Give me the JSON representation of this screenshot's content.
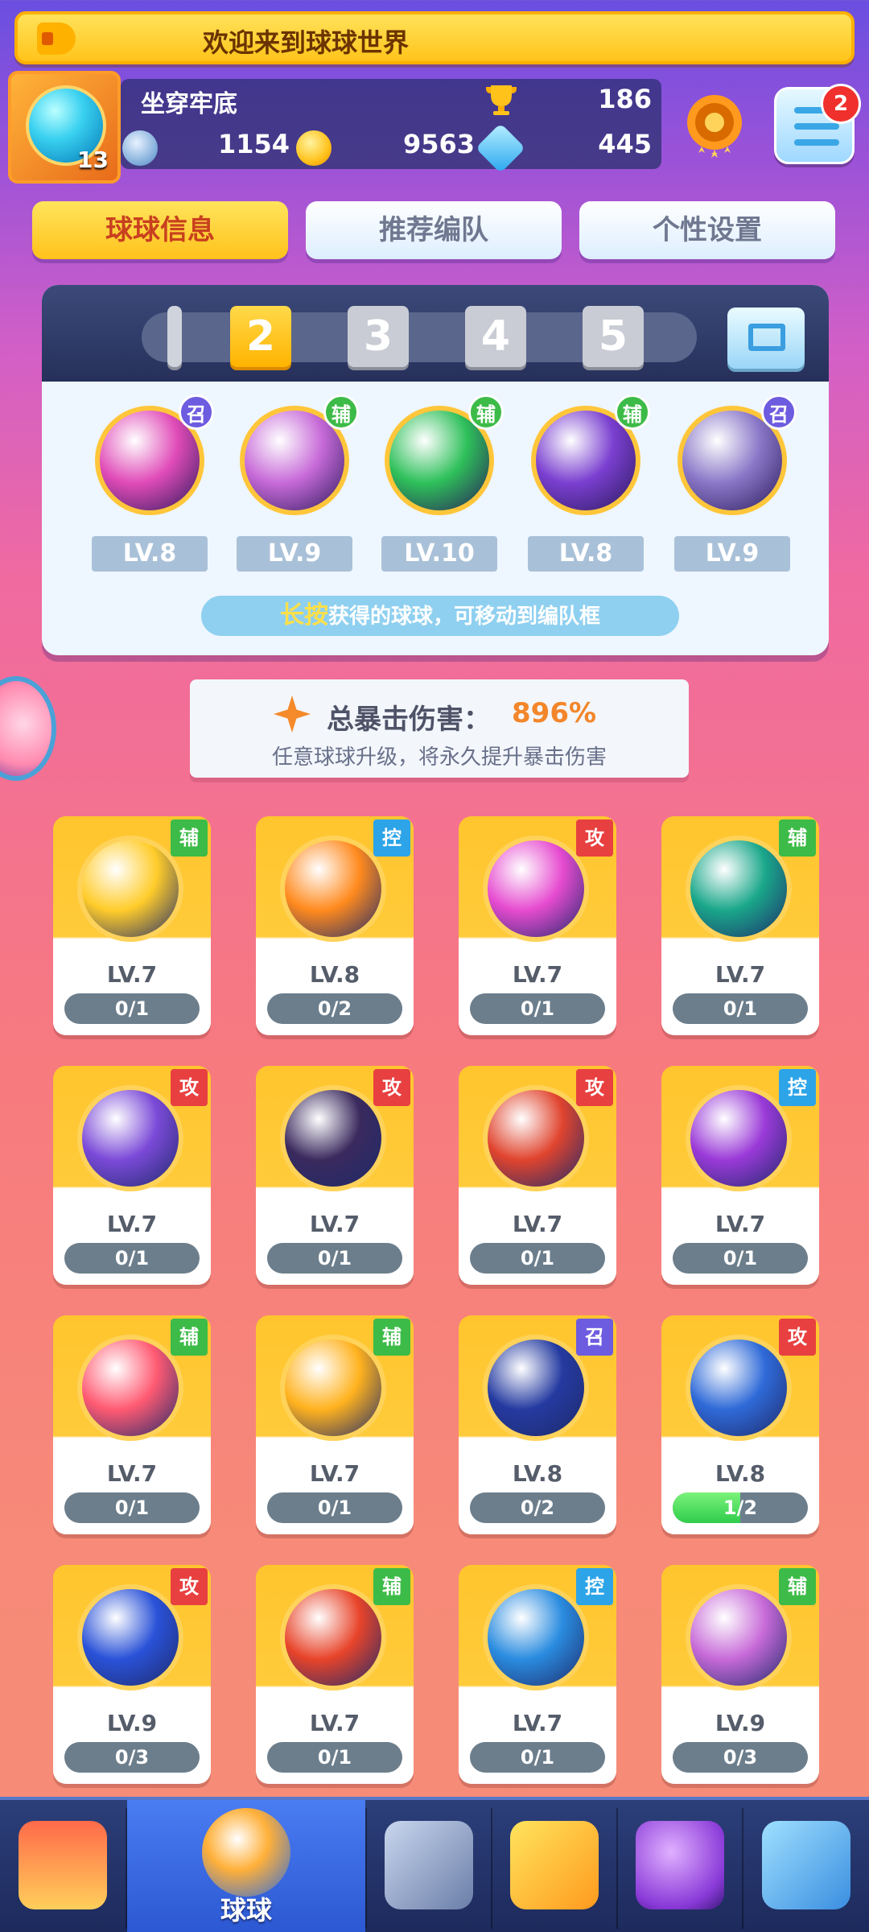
{
  "announcement": "欢迎来到球球世界",
  "player": {
    "name": "坐穿牢底",
    "level": "13",
    "trophies": "186",
    "resources": [
      {
        "icon": "blue-orb-icon",
        "value": "1154"
      },
      {
        "icon": "gold-coin-icon",
        "value": "9563"
      },
      {
        "icon": "diamond-icon",
        "value": "445"
      }
    ]
  },
  "menu": {
    "badge": "2"
  },
  "tabs": [
    {
      "label": "球球信息",
      "active": true
    },
    {
      "label": "推荐编队",
      "active": false
    },
    {
      "label": "个性设置",
      "active": false
    }
  ],
  "team": {
    "numbers": [
      "2",
      "3",
      "4",
      "5"
    ],
    "active_number": "2",
    "slots": [
      {
        "tag": "召",
        "level": "LV.8",
        "color": "#e04bb8"
      },
      {
        "tag": "辅",
        "level": "LV.9",
        "color": "#c76ad8"
      },
      {
        "tag": "辅",
        "level": "LV.10",
        "color": "#2ec05a"
      },
      {
        "tag": "辅",
        "level": "LV.8",
        "color": "#7a3fd0"
      },
      {
        "tag": "召",
        "level": "LV.9",
        "color": "#8a78c8"
      }
    ],
    "hint_highlight": "长按",
    "hint_text": "获得的球球，可移动到编队框"
  },
  "crit": {
    "label": "总暴击伤害：",
    "value": "896%",
    "sub": "任意球球升级，将永久提升暴击伤害"
  },
  "balls": [
    {
      "tag": "辅",
      "type": "aux",
      "level": "LV.7",
      "progress": "0/1",
      "fill": 0,
      "color": "#ffcc2a"
    },
    {
      "tag": "控",
      "type": "ctl",
      "level": "LV.8",
      "progress": "0/2",
      "fill": 0,
      "color": "#ff8a1e"
    },
    {
      "tag": "攻",
      "type": "atk",
      "level": "LV.7",
      "progress": "0/1",
      "fill": 0,
      "color": "#e64bd0"
    },
    {
      "tag": "辅",
      "type": "aux",
      "level": "LV.7",
      "progress": "0/1",
      "fill": 0,
      "color": "#1aa78a"
    },
    {
      "tag": "攻",
      "type": "atk",
      "level": "LV.7",
      "progress": "0/1",
      "fill": 0,
      "color": "#7b4ad8"
    },
    {
      "tag": "攻",
      "type": "atk",
      "level": "LV.7",
      "progress": "0/1",
      "fill": 0,
      "color": "#3a2a5e"
    },
    {
      "tag": "攻",
      "type": "atk",
      "level": "LV.7",
      "progress": "0/1",
      "fill": 0,
      "color": "#e0442e"
    },
    {
      "tag": "控",
      "type": "ctl",
      "level": "LV.7",
      "progress": "0/1",
      "fill": 0,
      "color": "#9a3ad8"
    },
    {
      "tag": "辅",
      "type": "aux",
      "level": "LV.7",
      "progress": "0/1",
      "fill": 0,
      "color": "#ff5a72"
    },
    {
      "tag": "辅",
      "type": "aux",
      "level": "LV.7",
      "progress": "0/1",
      "fill": 0,
      "color": "#ffb21e"
    },
    {
      "tag": "召",
      "type": "sum",
      "level": "LV.8",
      "progress": "0/2",
      "fill": 0,
      "color": "#243aa0"
    },
    {
      "tag": "攻",
      "type": "atk",
      "level": "LV.8",
      "progress": "1/2",
      "fill": 0.5,
      "color": "#2f6ad8"
    },
    {
      "tag": "攻",
      "type": "atk",
      "level": "LV.9",
      "progress": "0/3",
      "fill": 0,
      "color": "#2a52d8"
    },
    {
      "tag": "辅",
      "type": "aux",
      "level": "LV.7",
      "progress": "0/1",
      "fill": 0,
      "color": "#e8442a"
    },
    {
      "tag": "控",
      "type": "ctl",
      "level": "LV.7",
      "progress": "0/1",
      "fill": 0,
      "color": "#2a8ce0"
    },
    {
      "tag": "辅",
      "type": "aux",
      "level": "LV.9",
      "progress": "0/3",
      "fill": 0,
      "color": "#c76ad8"
    }
  ],
  "nav": [
    {
      "icon": "shop-icon",
      "label": "",
      "active": false
    },
    {
      "icon": "balls-icon",
      "label": "球球",
      "active": true
    },
    {
      "icon": "battle-swords-icon",
      "label": "",
      "active": false
    },
    {
      "icon": "whistle-icon",
      "label": "",
      "active": false
    },
    {
      "icon": "planet-icon",
      "label": "",
      "active": false
    },
    {
      "icon": "chat-heart-icon",
      "label": "",
      "active": false
    }
  ]
}
